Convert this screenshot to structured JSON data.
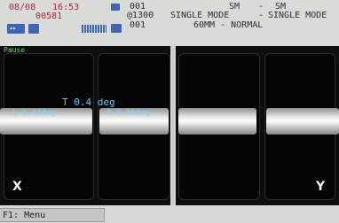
{
  "status": {
    "date": "08/08",
    "time": "16:53",
    "count": "00581",
    "prog_a": "001",
    "prog_b": "@1300",
    "prog_c": "001",
    "mode_left": "SINGLE MODE",
    "mode_sep": "-",
    "fiber_left": "SM",
    "fiber_right": "SM",
    "mode_right": "SINGLE MODE",
    "profile": "60MM - NORMAL"
  },
  "view": {
    "status_label": "Pause",
    "angle_label": "T 0.4 deg",
    "left_readout": "L 0.44deg",
    "right_readout": "R 0.39deg",
    "x_axis": "X",
    "y_axis": "Y"
  },
  "bottom": {
    "f1_label": "F1: Menu"
  },
  "colors": {
    "accent_cyan": "#59c8f2",
    "status_red": "#b0283a",
    "icon_blue": "#3f66b5",
    "pause_green": "#6bd466"
  },
  "icons": [
    "battery-icon",
    "display-mode-icon",
    "signal-icon",
    "heater-icon"
  ]
}
